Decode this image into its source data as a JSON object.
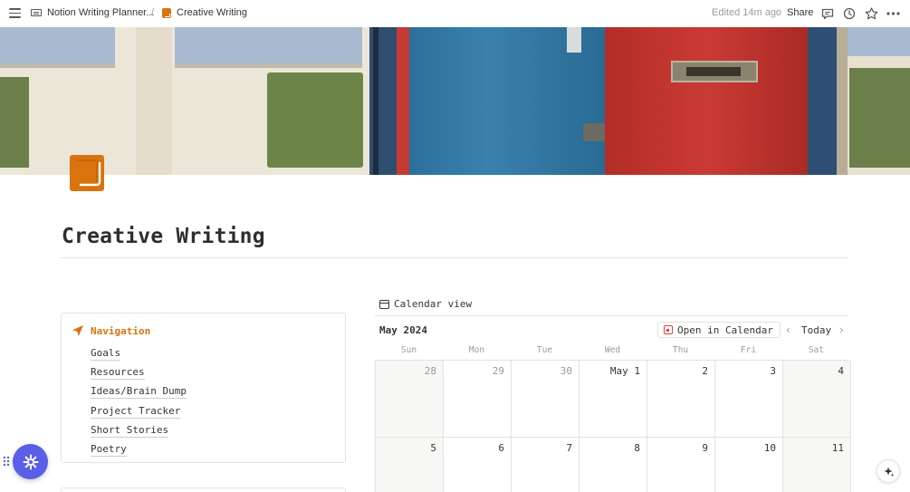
{
  "topbar": {
    "breadcrumb_parent": "Notion Writing Planner...",
    "separator": "/",
    "breadcrumb_current": "Creative Writing",
    "edited": "Edited 14m ago",
    "share": "Share",
    "icons": [
      "menu-icon",
      "comment-icon",
      "clock-icon",
      "star-icon",
      "more-icon"
    ]
  },
  "page": {
    "title": "Creative Writing",
    "icon": "book-icon"
  },
  "navigation": {
    "title": "Navigation",
    "items": [
      "Goals",
      "Resources",
      "Ideas/Brain Dump",
      "Project Tracker",
      "Short Stories",
      "Poetry"
    ]
  },
  "calendar": {
    "view_label": "Calendar view",
    "month": "May 2024",
    "open_label": "Open in Calendar",
    "today_label": "Today",
    "weekdays": [
      "Sun",
      "Mon",
      "Tue",
      "Wed",
      "Thu",
      "Fri",
      "Sat"
    ],
    "week1": [
      "28",
      "29",
      "30",
      "May 1",
      "2",
      "3",
      "4"
    ],
    "week2": [
      "5",
      "6",
      "7",
      "8",
      "9",
      "10",
      "11"
    ]
  },
  "colors": {
    "accent": "#d9730d",
    "fab": "#5b5fe8",
    "calendar_red": "#e03e3e"
  }
}
